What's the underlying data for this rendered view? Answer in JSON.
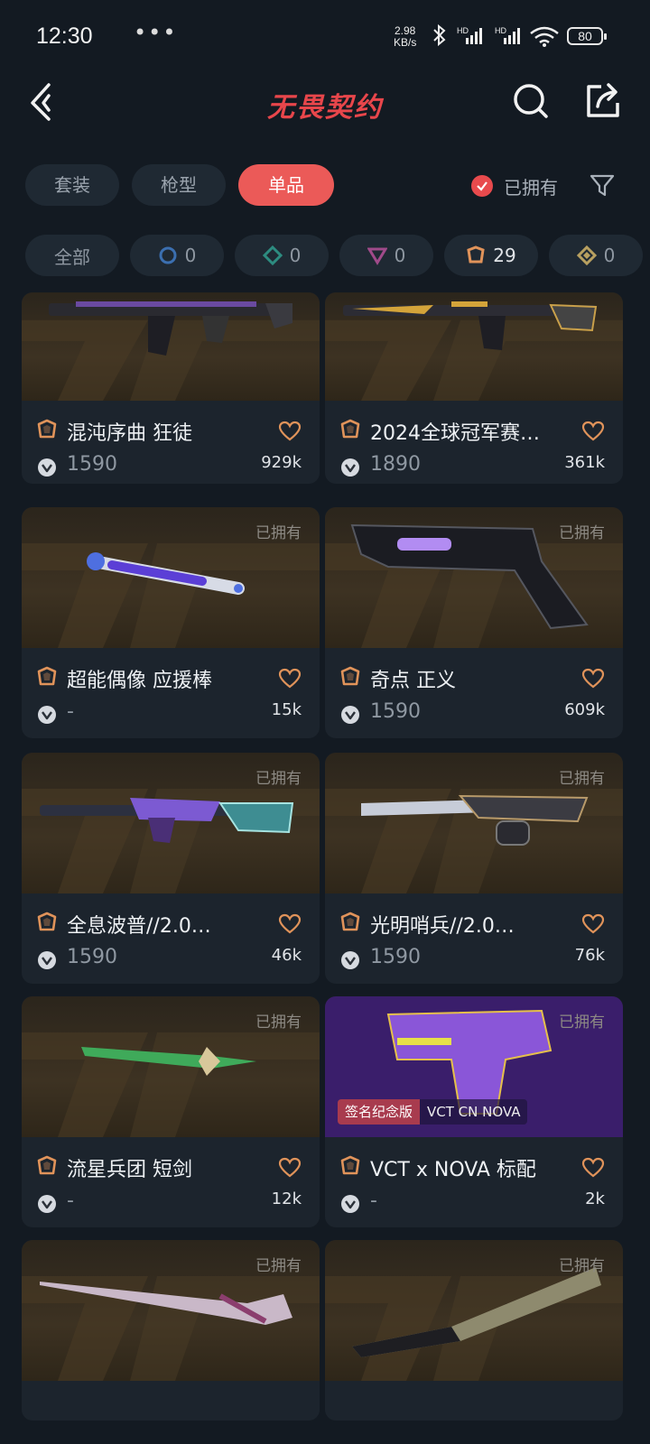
{
  "status": {
    "time": "12:30",
    "dots": "•••",
    "speed_top": "2.98",
    "speed_bottom": "KB/s",
    "battery": "80"
  },
  "nav": {
    "logo": "无畏契约"
  },
  "tabs": [
    "套装",
    "枪型",
    "单品"
  ],
  "owned_filter_label": "已拥有",
  "chips": [
    {
      "label": "全部",
      "icon": "none"
    },
    {
      "label": "0",
      "icon": "tier-select-icon",
      "color": "#3b6fb0"
    },
    {
      "label": "0",
      "icon": "tier-deluxe-icon",
      "color": "#2d8c80"
    },
    {
      "label": "0",
      "icon": "tier-premium-icon",
      "color": "#a04a8a"
    },
    {
      "label": "29",
      "icon": "tier-exclusive-icon",
      "color": "#e0935a"
    },
    {
      "label": "0",
      "icon": "tier-ultra-icon",
      "color": "#b8a060"
    }
  ],
  "cards": [
    {
      "name": "混沌序曲 狂徒",
      "price": "1590",
      "likes": "929k",
      "owned": "",
      "edition_a": "",
      "edition_b": ""
    },
    {
      "name": "2024全球冠军赛…",
      "price": "1890",
      "likes": "361k",
      "owned": "",
      "edition_a": "",
      "edition_b": ""
    },
    {
      "name": "超能偶像 应援棒",
      "price": "-",
      "likes": "15k",
      "owned": "已拥有",
      "edition_a": "",
      "edition_b": ""
    },
    {
      "name": "奇点 正义",
      "price": "1590",
      "likes": "609k",
      "owned": "已拥有",
      "edition_a": "",
      "edition_b": ""
    },
    {
      "name": "全息波普//2.0…",
      "price": "1590",
      "likes": "46k",
      "owned": "已拥有",
      "edition_a": "",
      "edition_b": ""
    },
    {
      "name": "光明哨兵//2.0…",
      "price": "1590",
      "likes": "76k",
      "owned": "已拥有",
      "edition_a": "",
      "edition_b": ""
    },
    {
      "name": "流星兵团 短剑",
      "price": "-",
      "likes": "12k",
      "owned": "已拥有",
      "edition_a": "",
      "edition_b": ""
    },
    {
      "name": "VCT x NOVA 标配",
      "price": "-",
      "likes": "2k",
      "owned": "已拥有",
      "edition_a": "签名纪念版",
      "edition_b": "VCT CN NOVA"
    },
    {
      "name": "",
      "price": "",
      "likes": "",
      "owned": "已拥有",
      "edition_a": "",
      "edition_b": ""
    },
    {
      "name": "",
      "price": "",
      "likes": "",
      "owned": "已拥有",
      "edition_a": "",
      "edition_b": ""
    }
  ]
}
